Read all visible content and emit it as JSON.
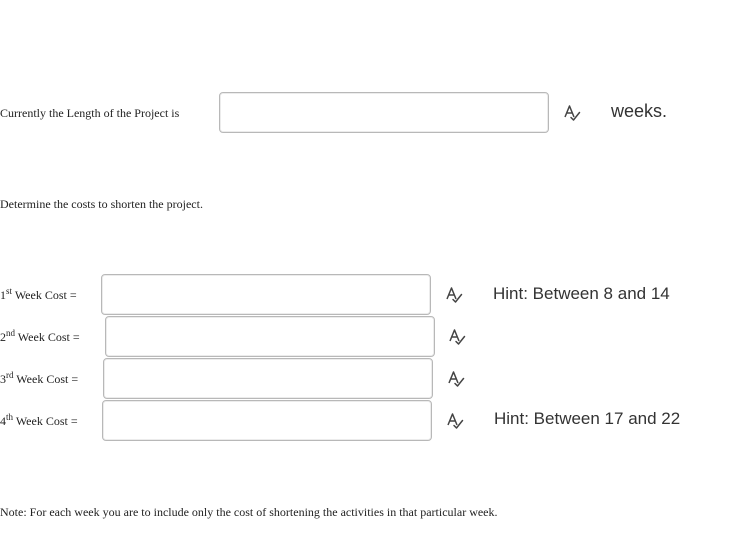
{
  "project_length": {
    "label": "Currently the Length of the Project is",
    "value": "",
    "unit": "weeks."
  },
  "instruction": "Determine the costs to shorten the project.",
  "week_costs": [
    {
      "num": "1",
      "suffix": "st",
      "label": "Week Cost =",
      "value": "",
      "hint": "Hint: Between 8 and 14"
    },
    {
      "num": "2",
      "suffix": "nd",
      "label": "Week Cost =",
      "value": "",
      "hint": ""
    },
    {
      "num": "3",
      "suffix": "rd",
      "label": "Week Cost =",
      "value": "",
      "hint": ""
    },
    {
      "num": "4",
      "suffix": "th",
      "label": "Week Cost =",
      "value": "",
      "hint": "Hint: Between 17 and 22"
    }
  ],
  "note": "Note: For each week you are to include only the cost of shortening the activities in that particular week.",
  "icons": {
    "spellcheck": "spellcheck-icon"
  }
}
